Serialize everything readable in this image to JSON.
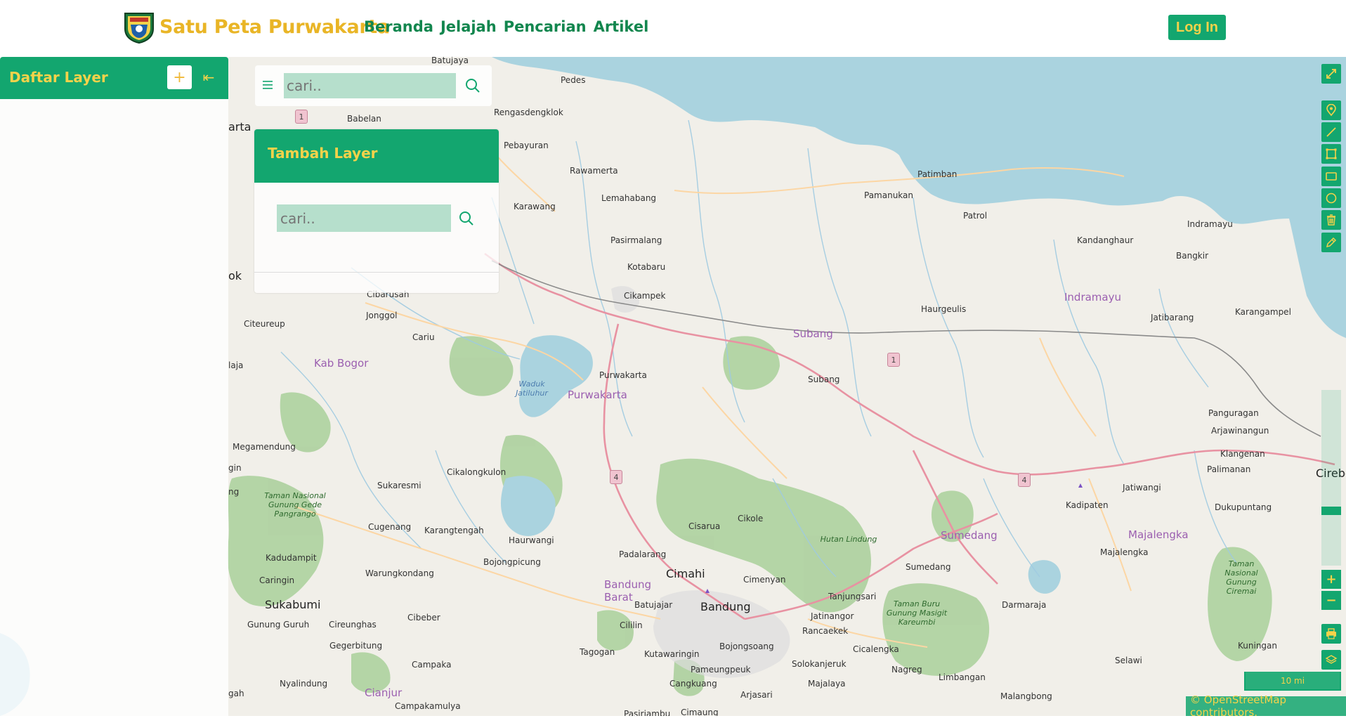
{
  "header": {
    "site_title": "Satu Peta Purwakarta",
    "nav": [
      "Beranda",
      "Jelajah",
      "Pencarian",
      "Artikel"
    ],
    "login_label": "Log In"
  },
  "sidebar": {
    "title": "Daftar Layer",
    "add_symbol": "+",
    "collapse_symbol": "⇤"
  },
  "search": {
    "placeholder": "cari.."
  },
  "add_layer_panel": {
    "title": "Tambah Layer",
    "placeholder": "cari.."
  },
  "map": {
    "scale_label": "10 mi",
    "attribution": "© OpenStreetMap contributors.",
    "labels": {
      "batujaya": "Batujaya",
      "pedes": "Pedes",
      "babelan": "Babelan",
      "rengasdengklok": "Rengasdengklok",
      "pebayuran": "Pebayuran",
      "rawamerta": "Rawamerta",
      "karawang": "Karawang",
      "lemahabang": "Lemahabang",
      "pasirmalang": "Pasirmalang",
      "kotabaru": "Kotabaru",
      "cikampek": "Cikampek",
      "patimban": "Patimban",
      "pamanukan": "Pamanukan",
      "patrol": "Patrol",
      "kandanghaur": "Kandanghaur",
      "indramayu_town": "Indramayu",
      "indramayu": "Indramayu",
      "bangkir": "Bangkir",
      "haurgeulis": "Haurgeulis",
      "jatibarang": "Jatibarang",
      "karangampel": "Karangampel",
      "subang": "Subang",
      "subang_town": "Subang",
      "purwakarta_town": "Purwakarta",
      "purwakarta": "Purwakarta",
      "waduk": "Waduk Jatiluhur",
      "kab_bogor": "Kab Bogor",
      "cibarusah": "Cibarusah",
      "jonggol": "Jonggol",
      "citeureup": "Citeureup",
      "cariu": "Cariu",
      "megamendung": "Megamendung",
      "cikalongkulon": "Cikalongkulon",
      "sukaresmi": "Sukaresmi",
      "cugenang": "Cugenang",
      "karangtengah": "Karangtengah",
      "haurwangi": "Haurwangi",
      "tn_gede": "Taman Nasional Gunung Gede Pangrango",
      "kadudampit": "Kadudampit",
      "warungkondang": "Warungkondang",
      "bojongpicung": "Bojongpicung",
      "padalarang": "Padalarang",
      "cimahi": "Cimahi",
      "cisarua": "Cisarua",
      "cikole": "Cikole",
      "cimenyan": "Cimenyan",
      "hutan_lindung": "Hutan Lindung",
      "sumedang": "Sumedang",
      "sumedang_town": "Sumedang",
      "caringin": "Caringin",
      "sukabumi": "Sukabumi",
      "bandung_barat": "Bandung Barat",
      "batujajar": "Batujajar",
      "bandung": "Bandung",
      "tanjungsari": "Tanjungsari",
      "jatinangor": "Jatinangor",
      "rancaekek": "Rancaekek",
      "cicalengka": "Cicalengka",
      "gunung_guruh": "Gunung Guruh",
      "cireunghas": "Cireunghas",
      "cibeber": "Cibeber",
      "cililin": "Cililin",
      "gegerbitung": "Gegerbitung",
      "tagogan": "Tagogan",
      "kutawaringin": "Kutawaringin",
      "bojongsoang": "Bojongsoang",
      "campaka": "Campaka",
      "pameungpeuk": "Pameungpeuk",
      "solokanjeruk": "Solokanjeruk",
      "nagreg": "Nagreg",
      "nyalindung": "Nyalindung",
      "cianjur": "Cianjur",
      "cangkuang": "Cangkuang",
      "arjasari": "Arjasari",
      "majalaya": "Majalaya",
      "limbangan": "Limbangan",
      "malangbong": "Malangbong",
      "campakamulya": "Campakamulya",
      "pasirjambu": "Pasirjambu",
      "cimaung": "Cimaung",
      "darmaraja": "Darmaraja",
      "tn_buru": "Taman Buru Gunung Masigit Kareumbi",
      "majalengka": "Majalengka",
      "majalengka_town": "Majalengka",
      "kadipaten": "Kadipaten",
      "jatiwangi": "Jatiwangi",
      "tn_ciremai": "Taman Nasional Gunung Ciremai",
      "kuningan": "Kuningan",
      "selawi": "Selawi",
      "panguragan": "Panguragan",
      "arjawinangun": "Arjawinangun",
      "klangenan": "Klangenan",
      "palimanan": "Palimanan",
      "cirebon": "Cirebo",
      "dukupuntang": "Dukupuntang",
      "arta": "arta",
      "ok": "ok",
      "laja": "laja",
      "gin": "gin",
      "ng": "ng",
      "gah": "gah",
      "rt1": "1",
      "rt4a": "4",
      "rt4b": "4",
      "rt1b": "1"
    }
  }
}
